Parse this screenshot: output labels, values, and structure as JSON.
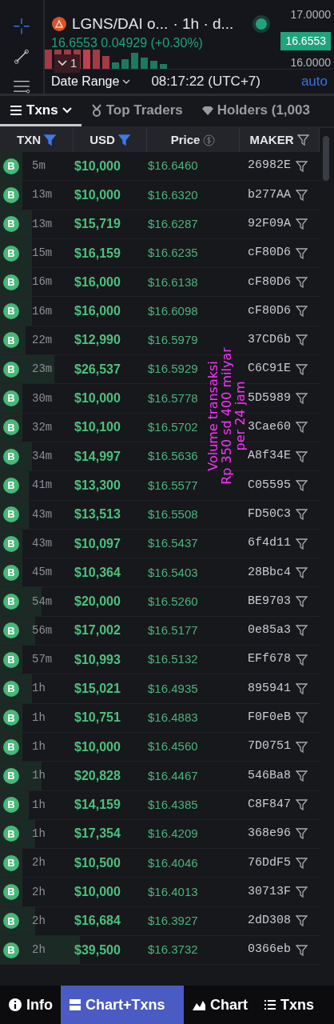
{
  "chart": {
    "pair": "LGNS/DAI o...",
    "interval": "· 1h · d...",
    "live": true,
    "quote": "16.6553 0.04929 (+0.30%)",
    "collapse": "1",
    "axis_labels": [
      "17.0000",
      "16.6553",
      "16.0000"
    ],
    "date_range": "Date Range",
    "time": "08:17:22 (UTC+7)",
    "scale": "auto"
  },
  "tabs": [
    {
      "label": "Txns",
      "kind": "txns",
      "selected": true
    },
    {
      "label": "Top Traders",
      "kind": "traders",
      "selected": false
    },
    {
      "label": "Holders (1,003",
      "kind": "holders",
      "selected": false
    }
  ],
  "columns": [
    {
      "label": "TXN",
      "kind": "filter",
      "filter_active": true
    },
    {
      "label": "USD",
      "kind": "filter",
      "filter_active": true
    },
    {
      "label": "Price",
      "kind": "currency",
      "filter_active": false
    },
    {
      "label": "MAKER",
      "kind": "filter",
      "filter_active": false
    }
  ],
  "rows": [
    {
      "type": "B",
      "age": "5m",
      "usd": "$10,000",
      "price": "$16.6460",
      "maker": "26982E",
      "level": 0.07
    },
    {
      "type": "B",
      "age": "13m",
      "usd": "$10,000",
      "price": "$16.6320",
      "maker": "b277AA",
      "level": 0.07
    },
    {
      "type": "B",
      "age": "13m",
      "usd": "$15,719",
      "price": "$16.6287",
      "maker": "92F09A",
      "level": 0.1
    },
    {
      "type": "B",
      "age": "15m",
      "usd": "$16,159",
      "price": "$16.6235",
      "maker": "cF80D6",
      "level": 0.1
    },
    {
      "type": "B",
      "age": "16m",
      "usd": "$16,000",
      "price": "$16.6138",
      "maker": "cF80D6",
      "level": 0.1
    },
    {
      "type": "B",
      "age": "16m",
      "usd": "$16,000",
      "price": "$16.6098",
      "maker": "cF80D6",
      "level": 0.1
    },
    {
      "type": "B",
      "age": "22m",
      "usd": "$12,990",
      "price": "$16.5979",
      "maker": "37CD6b",
      "level": 0.08
    },
    {
      "type": "B",
      "age": "23m",
      "usd": "$26,537",
      "price": "$16.5929",
      "maker": "C6C91E",
      "level": 0.17
    },
    {
      "type": "B",
      "age": "30m",
      "usd": "$10,000",
      "price": "$16.5778",
      "maker": "5D5989",
      "level": 0.07
    },
    {
      "type": "B",
      "age": "32m",
      "usd": "$10,100",
      "price": "$16.5702",
      "maker": "3Cae60",
      "level": 0.07
    },
    {
      "type": "B",
      "age": "34m",
      "usd": "$14,997",
      "price": "$16.5636",
      "maker": "A8f34E",
      "level": 0.1
    },
    {
      "type": "B",
      "age": "41m",
      "usd": "$13,300",
      "price": "$16.5577",
      "maker": "C05595",
      "level": 0.09
    },
    {
      "type": "B",
      "age": "43m",
      "usd": "$13,513",
      "price": "$16.5508",
      "maker": "FD50C3",
      "level": 0.09
    },
    {
      "type": "B",
      "age": "43m",
      "usd": "$10,097",
      "price": "$16.5437",
      "maker": "6f4d11",
      "level": 0.07
    },
    {
      "type": "B",
      "age": "45m",
      "usd": "$10,364",
      "price": "$16.5403",
      "maker": "28Bbc4",
      "level": 0.07
    },
    {
      "type": "B",
      "age": "54m",
      "usd": "$20,000",
      "price": "$16.5260",
      "maker": "BE9703",
      "level": 0.13
    },
    {
      "type": "B",
      "age": "56m",
      "usd": "$17,002",
      "price": "$16.5177",
      "maker": "0e85a3",
      "level": 0.11
    },
    {
      "type": "B",
      "age": "57m",
      "usd": "$10,993",
      "price": "$16.5132",
      "maker": "EFf678",
      "level": 0.07
    },
    {
      "type": "B",
      "age": "1h",
      "usd": "$15,021",
      "price": "$16.4935",
      "maker": "895941",
      "level": 0.1
    },
    {
      "type": "B",
      "age": "1h",
      "usd": "$10,751",
      "price": "$16.4883",
      "maker": "F0F0eB",
      "level": 0.07
    },
    {
      "type": "B",
      "age": "1h",
      "usd": "$10,000",
      "price": "$16.4560",
      "maker": "7D0751",
      "level": 0.07
    },
    {
      "type": "B",
      "age": "1h",
      "usd": "$20,828",
      "price": "$16.4467",
      "maker": "546Ba8",
      "level": 0.13
    },
    {
      "type": "B",
      "age": "1h",
      "usd": "$14,159",
      "price": "$16.4385",
      "maker": "C8F847",
      "level": 0.09
    },
    {
      "type": "B",
      "age": "1h",
      "usd": "$17,354",
      "price": "$16.4209",
      "maker": "368e96",
      "level": 0.11
    },
    {
      "type": "B",
      "age": "2h",
      "usd": "$10,500",
      "price": "$16.4046",
      "maker": "76DdF5",
      "level": 0.07
    },
    {
      "type": "B",
      "age": "2h",
      "usd": "$10,000",
      "price": "$16.4013",
      "maker": "30713F",
      "level": 0.07
    },
    {
      "type": "B",
      "age": "2h",
      "usd": "$16,684",
      "price": "$16.3927",
      "maker": "2dD308",
      "level": 0.11
    },
    {
      "type": "B",
      "age": "2h",
      "usd": "$39,500",
      "price": "$16.3732",
      "maker": "0366eb",
      "level": 0.25
    }
  ],
  "annotation": {
    "lines": [
      "Volume transaksi",
      "Rp 350 sd 400 milyar",
      "per 24 jam"
    ]
  },
  "bottom_nav": [
    {
      "label": "Info",
      "kind": "info",
      "selected": false
    },
    {
      "label": "Chart+Txns",
      "kind": "split",
      "selected": true
    },
    {
      "label": "Chart",
      "kind": "chart",
      "selected": false
    },
    {
      "label": "Txns",
      "kind": "list",
      "selected": false
    }
  ]
}
